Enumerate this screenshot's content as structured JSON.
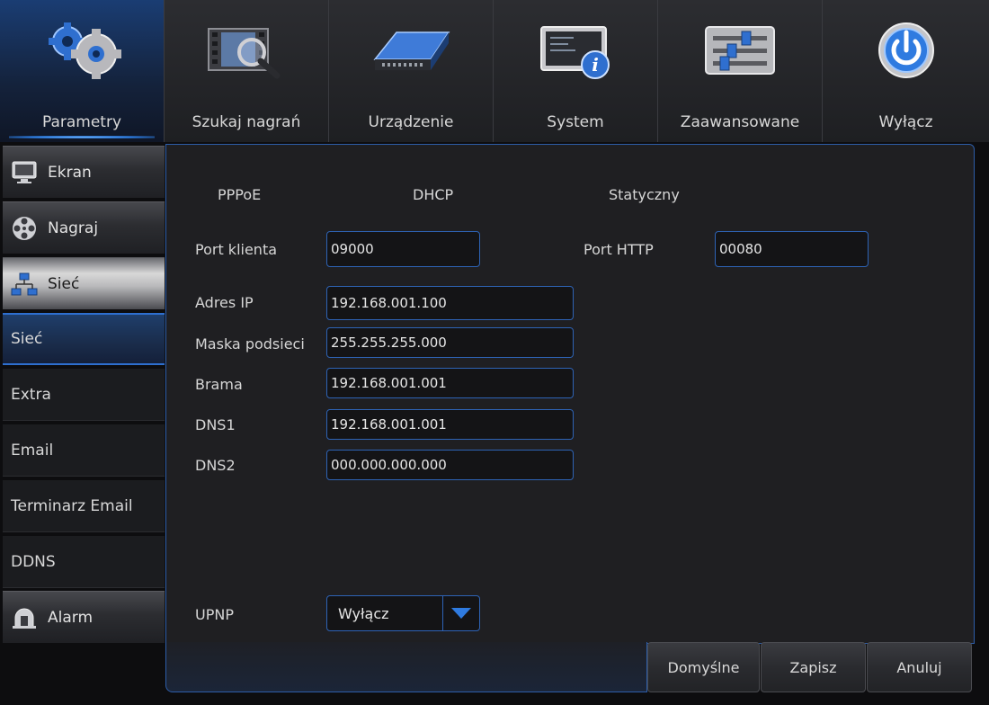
{
  "nav": {
    "tabs": [
      {
        "label": "Parametry",
        "icon": "gears-icon"
      },
      {
        "label": "Szukaj nagrań",
        "icon": "film-search-icon"
      },
      {
        "label": "Urządzenie",
        "icon": "hard-drive-icon"
      },
      {
        "label": "System",
        "icon": "monitor-info-icon"
      },
      {
        "label": "Zaawansowane",
        "icon": "sliders-icon"
      },
      {
        "label": "Wyłącz",
        "icon": "power-icon"
      }
    ]
  },
  "sidebar": {
    "categories": {
      "ekran": "Ekran",
      "nagraj": "Nagraj",
      "siec": "Sieć",
      "alarm": "Alarm"
    },
    "subitems": [
      "Sieć",
      "Extra",
      "Email",
      "Terminarz Email",
      "DDNS"
    ]
  },
  "network": {
    "modes": [
      "PPPoE",
      "DHCP",
      "Statyczny"
    ],
    "client_port_label": "Port klienta",
    "client_port": "09000",
    "http_port_label": "Port HTTP",
    "http_port": "00080",
    "ip_label": "Adres IP",
    "ip": "192.168.001.100",
    "mask_label": "Maska podsieci",
    "mask": "255.255.255.000",
    "gateway_label": "Brama",
    "gateway": "192.168.001.001",
    "dns1_label": "DNS1",
    "dns1": "192.168.001.001",
    "dns2_label": "DNS2",
    "dns2": "000.000.000.000",
    "upnp_label": "UPNP",
    "upnp_value": "Wyłącz"
  },
  "buttons": {
    "defaults": "Domyślne",
    "save": "Zapisz",
    "cancel": "Anuluj"
  },
  "colors": {
    "accent": "#2e6fcf",
    "background": "#1f1f22"
  }
}
